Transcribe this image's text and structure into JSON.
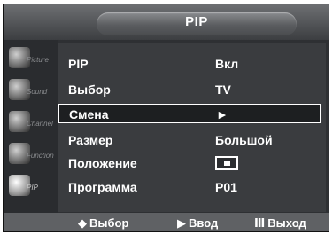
{
  "header": {
    "title": "PIP"
  },
  "sidebar": {
    "items": [
      {
        "label": "Picture",
        "icon": "picture-icon"
      },
      {
        "label": "Sound",
        "icon": "sound-icon"
      },
      {
        "label": "Channel",
        "icon": "channel-icon"
      },
      {
        "label": "Function",
        "icon": "function-icon"
      },
      {
        "label": "PIP",
        "icon": "pip-icon",
        "active": true
      }
    ]
  },
  "menu": {
    "rows": [
      {
        "label": "PIP",
        "value": "Вкл"
      },
      {
        "label": "Выбор",
        "value": "TV"
      },
      {
        "label": "Смена",
        "value": "►",
        "selected": true
      },
      {
        "label": "Размер",
        "value": "Большой"
      },
      {
        "label": "Положение",
        "value_icon": "position-box-icon"
      },
      {
        "label": "Программа",
        "value": "P01"
      }
    ]
  },
  "footer": {
    "select": {
      "glyph": "◆",
      "label": "Выбор"
    },
    "enter": {
      "glyph": "▶",
      "label": "Ввод"
    },
    "exit": {
      "glyph": "Ⅲ",
      "label": "Выход"
    }
  }
}
